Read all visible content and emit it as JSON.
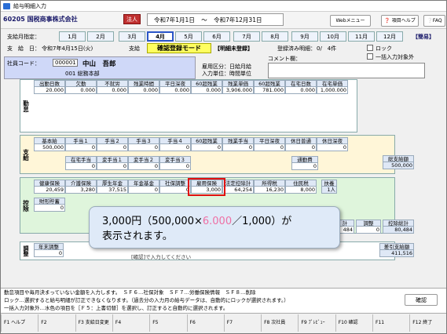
{
  "window": {
    "title": "給与明細入力"
  },
  "header": {
    "company": "60205 国税商事株式会社",
    "corp_badge": "法人",
    "period_start": "令和7年1月1日",
    "period_sep": "〜",
    "period_end": "令和7年12月31日",
    "web_menu": "Webメニュー",
    "item_help": "項目ヘルプ",
    "faq": "FAQ"
  },
  "months": {
    "label": "支給月指定：",
    "items": [
      "1月",
      "2月",
      "3月",
      "4月",
      "5月",
      "6月",
      "7月",
      "8月",
      "9月",
      "10月",
      "11月",
      "12月"
    ],
    "selected": "4月",
    "simple": "【簡易】"
  },
  "pay": {
    "label": "支　給　日：",
    "date": "令和7年4月15日(火)",
    "kind": "支給",
    "mode": "確認登録モード",
    "status": "【明細未登録】",
    "registered_label": "登録済み明細：",
    "registered_count": "0/　4件",
    "lock": "ロック",
    "bulk_exclude": "一括入力対象外"
  },
  "employee": {
    "code_label": "社員コード：",
    "code": "000001",
    "name": "中山　吾郎",
    "dept": "001 総務本部",
    "employ_type": "雇用区分：日給月給",
    "input_unit": "入力単位：時間単位",
    "comment_label": "コメント欄："
  },
  "work": {
    "label": "勤怠",
    "headers": [
      "出勤日数",
      "欠勤",
      "不就労",
      "残業時間",
      "平日深夜",
      "60超残業",
      "残業単価",
      "60超残業",
      "在宅日数",
      "在宅単価"
    ],
    "values": [
      "20.000",
      "0.000",
      "0.000",
      "0.000",
      "0.000",
      "0.000",
      "3,906.000",
      "781.000",
      "0.000",
      "1,000.000"
    ]
  },
  "payment": {
    "label": "支給",
    "row1_headers": [
      "基本給",
      "手当１",
      "手当２",
      "手当３",
      "手当４",
      "60超残業",
      "残業手当",
      "平日深夜",
      "休日普通",
      "休日深夜"
    ],
    "row1_values": [
      "500,000",
      "0",
      "0",
      "0",
      "0",
      "0",
      "0",
      "0",
      "0",
      "0"
    ],
    "row2_headers": [
      "在宅手当",
      "変手当１",
      "変手当２",
      "変手当３"
    ],
    "row2_values": [
      "0",
      "0",
      "0",
      "0"
    ],
    "commute_label": "通勤費",
    "commute_value": "0",
    "total_label": "総支給額",
    "total_value": "500,000"
  },
  "deduction": {
    "label": "控除",
    "headers": [
      "健康保険",
      "介護保険",
      "厚生年金",
      "年金基金",
      "社保調整",
      "雇用保険",
      "法定控除計",
      "所得税",
      "住民税",
      "扶養"
    ],
    "values": [
      "20,459",
      "3,280",
      "37,515",
      "0",
      "0",
      "3,000",
      "64,254",
      "16,230",
      "8,000",
      "1人"
    ],
    "row2_headers": [
      "財形貯蓄"
    ],
    "row2_values": [
      "0"
    ],
    "right_headers": [
      "計",
      "調整",
      "控除総計"
    ],
    "right_values": [
      "484",
      "0",
      "80,484"
    ]
  },
  "adjust": {
    "label": "調整",
    "headers": [
      "年末調整"
    ],
    "values": [
      "0"
    ],
    "net_label": "差引支給額",
    "net_value": "411,516",
    "note": "[確認]で入力してください"
  },
  "callout": {
    "line1_prefix": "3,000円（500,000×",
    "line1_rate": "6.000",
    "line1_suffix": "／1,000）が",
    "line2": "表示されます。"
  },
  "messages": {
    "line1": "勤怠項目や毎月決まっていない金額を入力します。　ＳＦ６…社保対象　ＳＦ７…労働保険情報　ＳＦ８…削除",
    "line2": "ロック…選択すると給与明細が訂正できなくなります。（過去分の入力月の給与データは、自動的にロックが選択されます。）",
    "line3": "一括入力対象外…水色の項目を［Ｆ５：上書切替］を選択し、訂正すると自動的に選択されます。",
    "confirm": "確認"
  },
  "fkeys": [
    "F1 ヘルプ",
    "F2",
    "F3 支給日変更",
    "F4",
    "F5",
    "F6",
    "F7",
    "F8 次社員",
    "F9 ﾌﾟﾚﾋﾞｭｰ",
    "F10 確認",
    "F11",
    "F12 終了"
  ],
  "colors": {
    "accent": "#2a55c8",
    "highlight": "#e01010",
    "corp_badge": "#c03030",
    "mode_bg": "#ffff60"
  }
}
